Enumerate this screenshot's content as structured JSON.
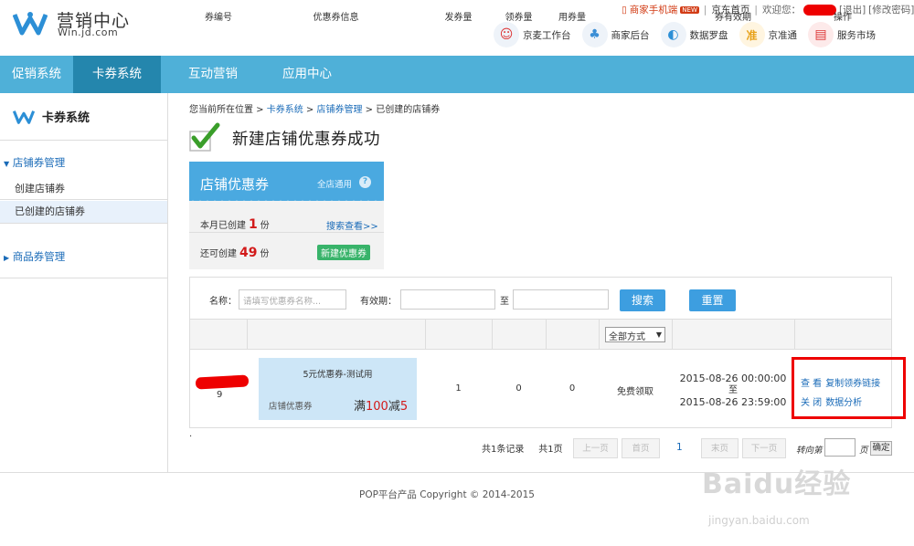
{
  "header": {
    "logo_title": "营销中心",
    "logo_sub": "Win.jd.com",
    "mobile_link": "商家手机端",
    "new_badge": "NEW",
    "home_link": "京东首页",
    "welcome": "欢迎您：",
    "logout": "[退出]",
    "change_pwd": "[修改密码]",
    "tools": [
      {
        "label": "京麦工作台",
        "icon": "jingmai-icon",
        "glyph": "☺"
      },
      {
        "label": "商家后台",
        "icon": "group-icon",
        "glyph": "♣"
      },
      {
        "label": "数据罗盘",
        "icon": "compass-icon",
        "glyph": "◐"
      },
      {
        "label": "京准通",
        "icon": "zhun-icon",
        "glyph": "准"
      },
      {
        "label": "服务市场",
        "icon": "store-icon",
        "glyph": "▤"
      }
    ]
  },
  "nav": [
    "促销系统",
    "卡券系统",
    "互动营销",
    "应用中心"
  ],
  "sidebar": {
    "title": "卡券系统",
    "group1": "店铺券管理",
    "items": [
      "创建店铺券",
      "已创建的店铺券"
    ],
    "group2": "商品券管理"
  },
  "breadcrumb": {
    "prefix": "您当前所在位置 > ",
    "l1": "卡券系统",
    "sep": " > ",
    "l2": "店铺券管理",
    "l3": "已创建的店铺券"
  },
  "success_title": "新建店铺优惠券成功",
  "card": {
    "title": "店铺优惠券",
    "scope": "全店通用",
    "help": "?",
    "created_label": "本月已创建",
    "created_count": "1",
    "unit": "份",
    "remain_label": "还可创建",
    "remain_count": "49",
    "search_link": "搜索查看>>",
    "new_button": "新建优惠券"
  },
  "filters": {
    "name_label": "名称：",
    "name_placeholder": "请填写优惠券名称...",
    "valid_label": "有效期：",
    "to": "至",
    "search": "搜索",
    "reset": "重置"
  },
  "table": {
    "headers": [
      "券编号",
      "优惠券信息",
      "发券量",
      "领券量",
      "用券量",
      "全部方式",
      "券有效期",
      "操作"
    ],
    "row": {
      "id": "9",
      "coupon_name": "5元优惠券-测试用",
      "coupon_type": "店铺优惠券",
      "amount_prefix": "满",
      "amount_min": "100",
      "amount_mid": "减",
      "amount_off": "5",
      "issued": "1",
      "claimed": "0",
      "used": "0",
      "method": "免费领取",
      "valid_from": "2015-08-26 00:00:00",
      "valid_to_word": "至",
      "valid_to": "2015-08-26 23:59:00",
      "ops": [
        "查 看",
        "复制领券链接",
        "关 闭",
        "数据分析"
      ]
    }
  },
  "pager": {
    "total": "共1条记录",
    "pages": "共1页",
    "prev": "上一页",
    "first": "首页",
    "current": "1",
    "last": "末页",
    "next": "下一页",
    "goto": "转向第",
    "page_word": "页",
    "ok": "确定"
  },
  "dot": ".",
  "footer": "POP平台产品 Copyright © 2014-2015",
  "watermark": {
    "big": "Baidu经验",
    "small": "jingyan.baidu.com"
  }
}
